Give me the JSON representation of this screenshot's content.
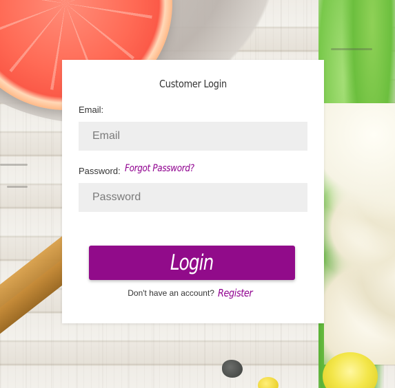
{
  "login_card": {
    "title": "Customer Login",
    "email_label": "Email:",
    "email_placeholder": "Email",
    "password_label": "Password:",
    "forgot_link": "Forgot Password?",
    "password_placeholder": "Password",
    "login_button": "Login",
    "register_prompt": "Don't have an account?",
    "register_link": "Register"
  },
  "colors": {
    "accent": "#910b8a",
    "link": "#8f008f",
    "input_bg": "#eeeeee",
    "card_bg": "#ffffff"
  }
}
